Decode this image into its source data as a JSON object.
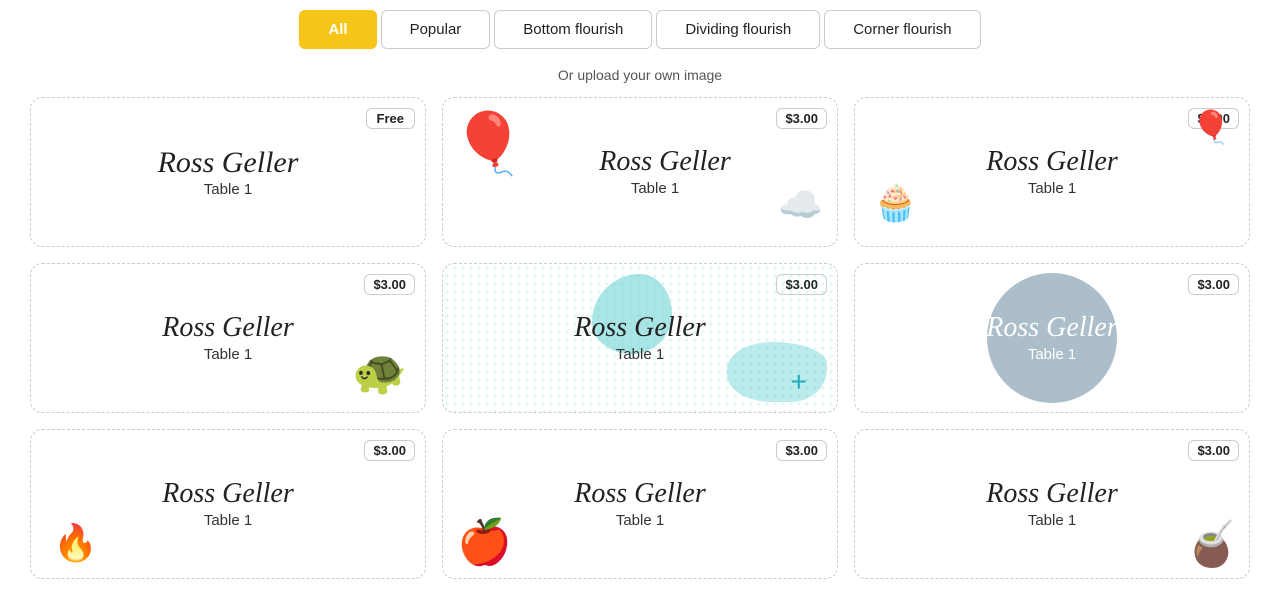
{
  "nav": {
    "buttons": [
      {
        "id": "all",
        "label": "All",
        "active": true
      },
      {
        "id": "popular",
        "label": "Popular",
        "active": false
      },
      {
        "id": "bottom-flourish",
        "label": "Bottom flourish",
        "active": false
      },
      {
        "id": "dividing-flourish",
        "label": "Dividing flourish",
        "active": false
      },
      {
        "id": "corner-flourish",
        "label": "Corner flourish",
        "active": false
      }
    ]
  },
  "upload_hint": "Or upload your own image",
  "cards": [
    {
      "id": 1,
      "name": "Ross Geller",
      "table": "Table 1",
      "price": "Free",
      "type": "free"
    },
    {
      "id": 2,
      "name": "Ross Geller",
      "table": "Table 1",
      "price": "$3.00",
      "type": "balloon"
    },
    {
      "id": 3,
      "name": "Ross Geller",
      "table": "Table 1",
      "price": "$3.00",
      "type": "birthday"
    },
    {
      "id": 4,
      "name": "Ross Geller",
      "table": "Table 1",
      "price": "$3.00",
      "type": "turtle"
    },
    {
      "id": 5,
      "name": "Ross Geller",
      "table": "Table 1",
      "price": "$3.00",
      "type": "blob"
    },
    {
      "id": 6,
      "name": "Ross Geller",
      "table": "Table 1",
      "price": "$3.00",
      "type": "circle"
    },
    {
      "id": 7,
      "name": "Ross Geller",
      "table": "Table 1",
      "price": "$3.00",
      "type": "fire"
    },
    {
      "id": 8,
      "name": "Ross Geller",
      "table": "Table 1",
      "price": "$3.00",
      "type": "apple"
    },
    {
      "id": 9,
      "name": "Ross Geller",
      "table": "Table 1",
      "price": "$3.00",
      "type": "mug"
    }
  ]
}
